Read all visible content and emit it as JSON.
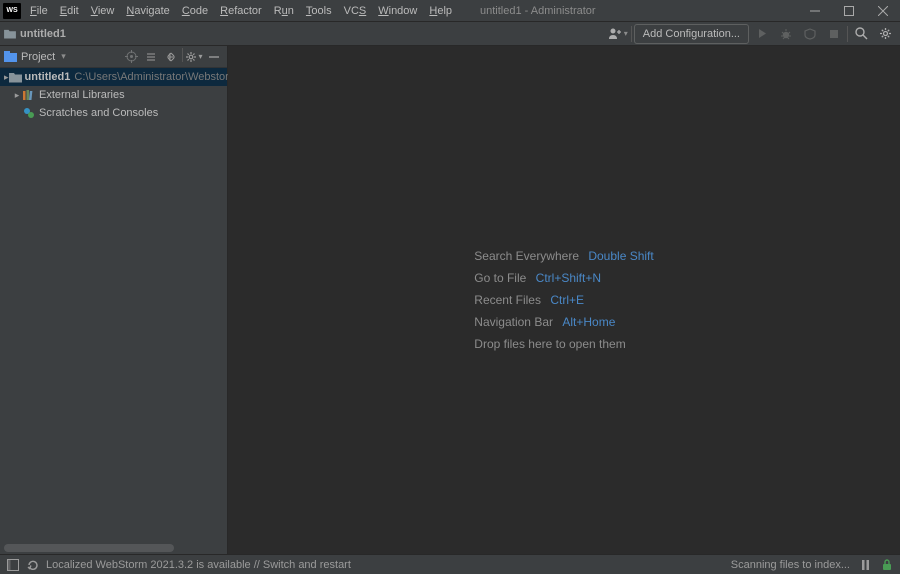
{
  "window": {
    "title": "untitled1 - Administrator"
  },
  "menubar": [
    {
      "label": "File",
      "u": "F"
    },
    {
      "label": "Edit",
      "u": "E"
    },
    {
      "label": "View",
      "u": "V"
    },
    {
      "label": "Navigate",
      "u": "N"
    },
    {
      "label": "Code",
      "u": "C"
    },
    {
      "label": "Refactor",
      "u": "R"
    },
    {
      "label": "Run",
      "u": "u",
      "full": "R<u>u</u>n"
    },
    {
      "label": "Tools",
      "u": "T"
    },
    {
      "label": "VCS",
      "u": "S",
      "full": "VC<u>S</u>"
    },
    {
      "label": "Window",
      "u": "W"
    },
    {
      "label": "Help",
      "u": "H"
    }
  ],
  "breadcrumb": {
    "project": "untitled1"
  },
  "toolbar": {
    "add_config": "Add Configuration..."
  },
  "sidebar": {
    "title": "Project",
    "tree": {
      "root": {
        "name": "untitled1",
        "path": "C:\\Users\\Administrator\\WebstormProjects\\"
      },
      "ext_libs": "External Libraries",
      "scratches": "Scratches and Consoles"
    }
  },
  "welcome": [
    {
      "label": "Search Everywhere",
      "shortcut": "Double Shift"
    },
    {
      "label": "Go to File",
      "shortcut": "Ctrl+Shift+N"
    },
    {
      "label": "Recent Files",
      "shortcut": "Ctrl+E"
    },
    {
      "label": "Navigation Bar",
      "shortcut": "Alt+Home"
    },
    {
      "label": "Drop files here to open them",
      "shortcut": ""
    }
  ],
  "statusbar": {
    "message": "Localized WebStorm 2021.3.2 is available // Switch and restart",
    "right": "Scanning files to index..."
  }
}
